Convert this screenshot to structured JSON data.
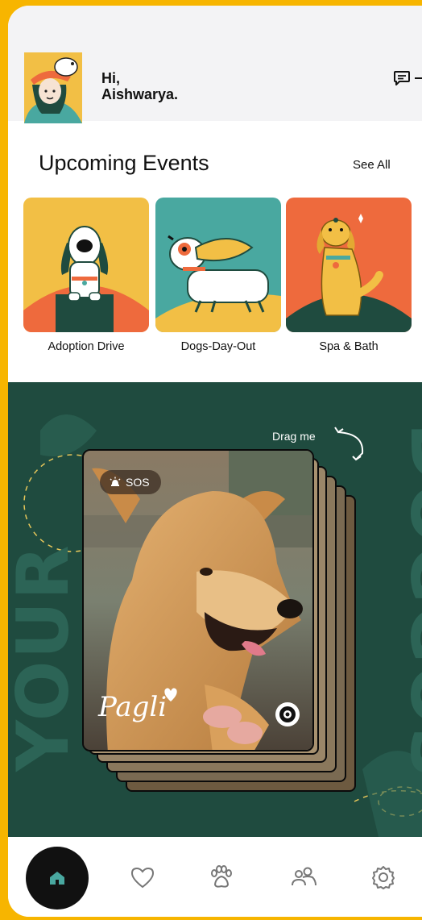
{
  "header": {
    "greeting_line1": "Hi,",
    "greeting_line2": "Aishwarya.",
    "message_icon": "chat-icon"
  },
  "events": {
    "title": "Upcoming Events",
    "see_all": "See All",
    "items": [
      {
        "label": "Adoption Drive"
      },
      {
        "label": "Dogs-Day-Out"
      },
      {
        "label": "Spa & Bath"
      }
    ]
  },
  "doggos": {
    "background_words": [
      "YOUR",
      "DOGGOS"
    ],
    "drag_hint": "Drag me",
    "card": {
      "sos_label": "SOS",
      "pet_name": "Pagli"
    }
  },
  "tabbar": {
    "items": [
      {
        "icon": "home-icon",
        "active": true
      },
      {
        "icon": "heart-icon",
        "active": false
      },
      {
        "icon": "paw-icon",
        "active": false
      },
      {
        "icon": "people-icon",
        "active": false
      },
      {
        "icon": "settings-icon",
        "active": false
      }
    ]
  },
  "colors": {
    "frame": "#F7B500",
    "doggos_bg": "#1F4B3F",
    "accent_teal": "#49A8A0",
    "event_orange": "#EE6A3D",
    "event_yellow": "#F2BF45"
  }
}
